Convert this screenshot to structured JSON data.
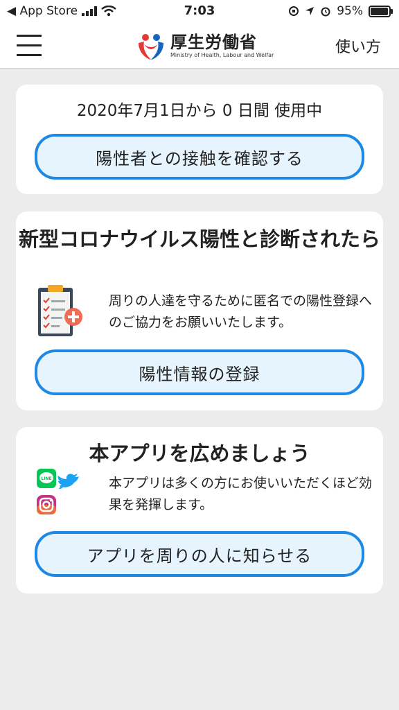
{
  "status_bar": {
    "back_label": "◀ App Store",
    "time": "7:03",
    "battery": "95%",
    "battery_level": 0.95
  },
  "header": {
    "logo_title": "厚生労働省",
    "logo_subtitle": "Ministry of Health, Labour and Welfar",
    "howto_label": "使い方"
  },
  "usage_card": {
    "usage_text": "2020年7月1日から 0 日間 使用中",
    "check_button": "陽性者との接触を確認する"
  },
  "positive_card": {
    "title": "新型コロナウイルス陽性と診断されたら",
    "description": "周りの人達を守るために匿名での陽性登録へのご協力をお願いいたします。",
    "register_button": "陽性情報の登録"
  },
  "share_card": {
    "title": "本アプリを広めましょう",
    "description": "本アプリは多くの方にお使いいただくほど効果を発揮します。",
    "share_button": "アプリを周りの人に知らせる",
    "line_label": "LINE"
  },
  "colors": {
    "accent": "#1e88e5",
    "button_bg": "#e6f4fd",
    "line_green": "#06c755",
    "twitter_blue": "#1da1f2",
    "logo_red": "#e53935",
    "logo_blue": "#1565c0"
  }
}
